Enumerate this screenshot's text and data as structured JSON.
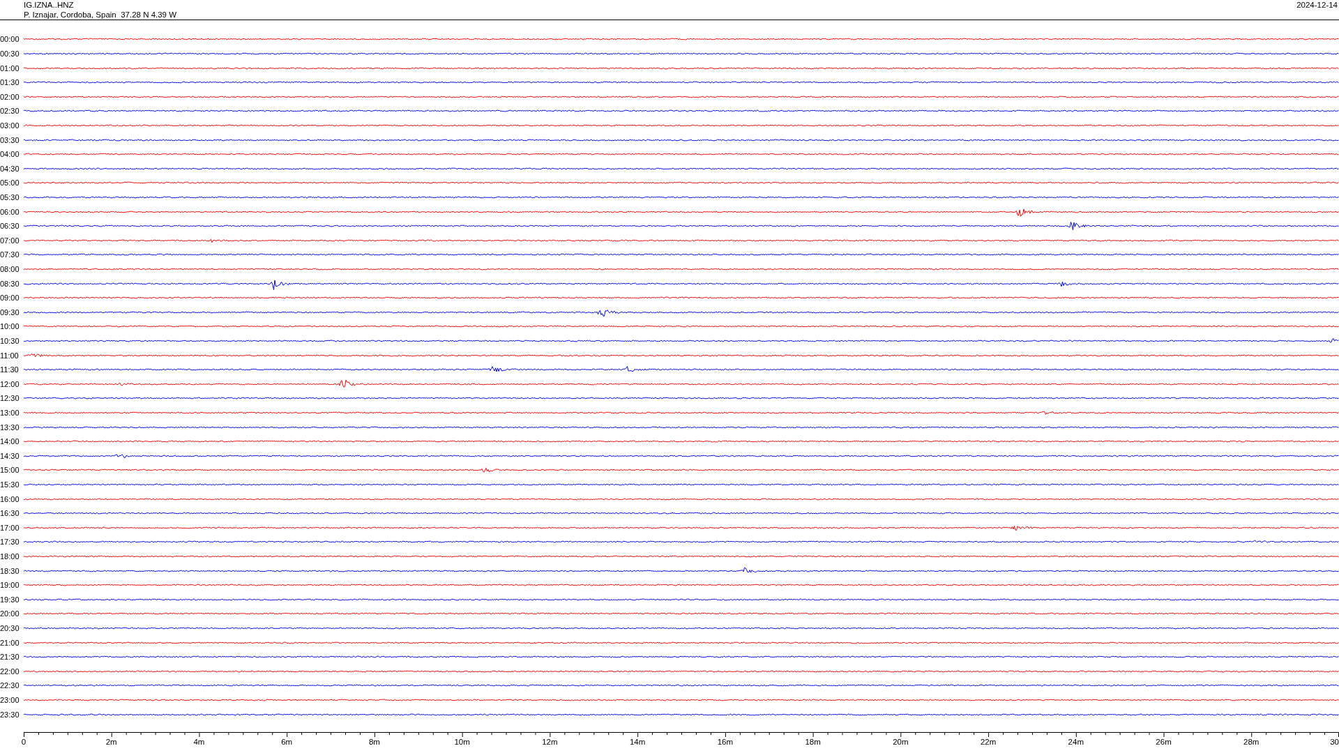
{
  "header": {
    "station": "IG.IZNA..HNZ",
    "location": "P. Iznajar, Cordoba, Spain  37.28 N 4.39 W",
    "date": "2024-12-14"
  },
  "traces": [
    {
      "time": "00:00",
      "color": "#ff0000"
    },
    {
      "time": "00:30",
      "color": "#0000ff"
    },
    {
      "time": "01:00",
      "color": "#ff0000"
    },
    {
      "time": "01:30",
      "color": "#0000ff"
    },
    {
      "time": "02:00",
      "color": "#ff0000"
    },
    {
      "time": "02:30",
      "color": "#0000ff"
    },
    {
      "time": "03:00",
      "color": "#ff0000"
    },
    {
      "time": "03:30",
      "color": "#0000ff"
    },
    {
      "time": "04:00",
      "color": "#ff0000"
    },
    {
      "time": "04:30",
      "color": "#0000ff"
    },
    {
      "time": "05:00",
      "color": "#ff0000"
    },
    {
      "time": "05:30",
      "color": "#0000ff"
    },
    {
      "time": "06:00",
      "color": "#ff0000"
    },
    {
      "time": "06:30",
      "color": "#0000ff"
    },
    {
      "time": "07:00",
      "color": "#ff0000"
    },
    {
      "time": "07:30",
      "color": "#0000ff"
    },
    {
      "time": "08:00",
      "color": "#ff0000"
    },
    {
      "time": "08:30",
      "color": "#0000ff"
    },
    {
      "time": "09:00",
      "color": "#ff0000"
    },
    {
      "time": "09:30",
      "color": "#0000ff"
    },
    {
      "time": "10:00",
      "color": "#ff0000"
    },
    {
      "time": "10:30",
      "color": "#0000ff"
    },
    {
      "time": "11:00",
      "color": "#ff0000"
    },
    {
      "time": "11:30",
      "color": "#0000ff"
    },
    {
      "time": "12:00",
      "color": "#ff0000"
    },
    {
      "time": "12:30",
      "color": "#0000ff"
    },
    {
      "time": "13:00",
      "color": "#ff0000"
    },
    {
      "time": "13:30",
      "color": "#0000ff"
    },
    {
      "time": "14:00",
      "color": "#ff0000"
    },
    {
      "time": "14:30",
      "color": "#0000ff"
    },
    {
      "time": "15:00",
      "color": "#ff0000"
    },
    {
      "time": "15:30",
      "color": "#0000ff"
    },
    {
      "time": "16:00",
      "color": "#ff0000"
    },
    {
      "time": "16:30",
      "color": "#0000ff"
    },
    {
      "time": "17:00",
      "color": "#ff0000"
    },
    {
      "time": "17:30",
      "color": "#0000ff"
    },
    {
      "time": "18:00",
      "color": "#ff0000"
    },
    {
      "time": "18:30",
      "color": "#0000ff"
    },
    {
      "time": "19:00",
      "color": "#ff0000"
    },
    {
      "time": "19:30",
      "color": "#0000ff"
    },
    {
      "time": "20:00",
      "color": "#ff0000"
    },
    {
      "time": "20:30",
      "color": "#0000ff"
    },
    {
      "time": "21:00",
      "color": "#ff0000"
    },
    {
      "time": "21:30",
      "color": "#0000ff"
    },
    {
      "time": "22:00",
      "color": "#ff0000"
    },
    {
      "time": "22:30",
      "color": "#0000ff"
    },
    {
      "time": "23:00",
      "color": "#ff0000"
    },
    {
      "time": "23:30",
      "color": "#0000ff"
    }
  ],
  "time_axis": {
    "labels": [
      "0",
      "2m",
      "4m",
      "6m",
      "8m",
      "10m",
      "12m",
      "14m",
      "16m",
      "18m",
      "20m",
      "22m",
      "24m",
      "26m",
      "28m",
      "30"
    ]
  }
}
